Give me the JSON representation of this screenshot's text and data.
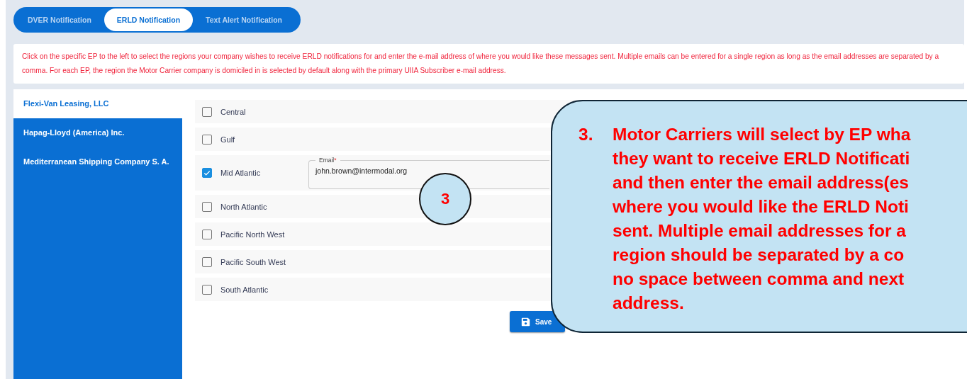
{
  "tabs": [
    {
      "label": "DVER Notification",
      "selected": false
    },
    {
      "label": "ERLD Notification",
      "selected": true
    },
    {
      "label": "Text Alert Notification",
      "selected": false
    }
  ],
  "instructions": "Click on the specific EP to the left to select the regions your company wishes to receive ERLD notifications for and enter the e-mail address of where you would like these messages sent. Multiple emails can be entered for a single region as long as the email addresses are separated by a comma. For each EP, the region the Motor Carrier company is domiciled in is selected by default along with the primary UIIA Subscriber e-mail address.",
  "sidebar": {
    "items": [
      {
        "label": "Flexi-Van Leasing, LLC",
        "selected": true
      },
      {
        "label": "Hapag-Lloyd (America) Inc.",
        "selected": false
      },
      {
        "label": "Mediterranean Shipping Company S. A.",
        "selected": false
      }
    ]
  },
  "regions": [
    {
      "label": "Central",
      "checked": false
    },
    {
      "label": "Gulf",
      "checked": false
    },
    {
      "label": "Mid Atlantic",
      "checked": true,
      "email": {
        "label": "Email",
        "required_mark": "*",
        "value": "john.brown@intermodal.org"
      }
    },
    {
      "label": "North Atlantic",
      "checked": false
    },
    {
      "label": "Pacific North West",
      "checked": false
    },
    {
      "label": "Pacific South West",
      "checked": false
    },
    {
      "label": "South Atlantic",
      "checked": false
    }
  ],
  "save_button": "Save",
  "step_marker": "3",
  "callout": {
    "number": "3.",
    "lines": [
      "Motor Carriers will select by EP wha",
      "they want to receive ERLD Notificati",
      "and then enter the email address(es",
      "where you would like the ERLD Noti",
      "sent.  Multiple email addresses for a",
      "region should be separated by a co",
      "no space between comma and next",
      "address."
    ]
  }
}
